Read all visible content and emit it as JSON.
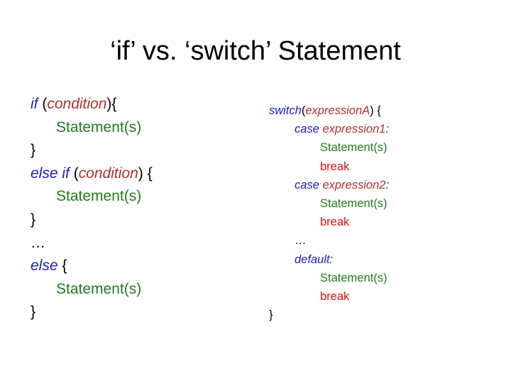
{
  "title": "‘if’ vs. ‘switch’ Statement",
  "colors": {
    "keyword": "#1b1bc4",
    "expression": "#b0312c",
    "statement": "#217a1f",
    "break": "#dd1010",
    "text": "#000000"
  },
  "if_code": {
    "if_kw": "if",
    "open_paren": "(",
    "condition1": "condition",
    "close1": "){",
    "stmt1": "Statement(s)",
    "brace1": "}",
    "else_if_kw": "else if",
    "open_paren2": "(",
    "condition2": "condition",
    "close2": ") {",
    "stmt2": "Statement(s)",
    "brace2": "}",
    "ellipsis": "…",
    "else_kw": "else",
    "open3": " {",
    "stmt3": "Statement(s)",
    "brace3": "}"
  },
  "switch_code": {
    "switch_kw": "switch",
    "open_paren": "(",
    "expressionA": "expressionA",
    "close": ") {",
    "case1_kw": "case",
    "case1_expr": "expression1",
    "colon1": ":",
    "case1_stmt": "Statement(s)",
    "case1_break": "break",
    "case2_kw": "case",
    "case2_expr": "expression2",
    "colon2": ":",
    "case2_stmt": "Statement(s)",
    "case2_break": "break",
    "ellipsis": "…",
    "default_kw": "default",
    "colon3": ":",
    "default_stmt": "Statement(s)",
    "default_break": "break",
    "close_brace": "}"
  }
}
